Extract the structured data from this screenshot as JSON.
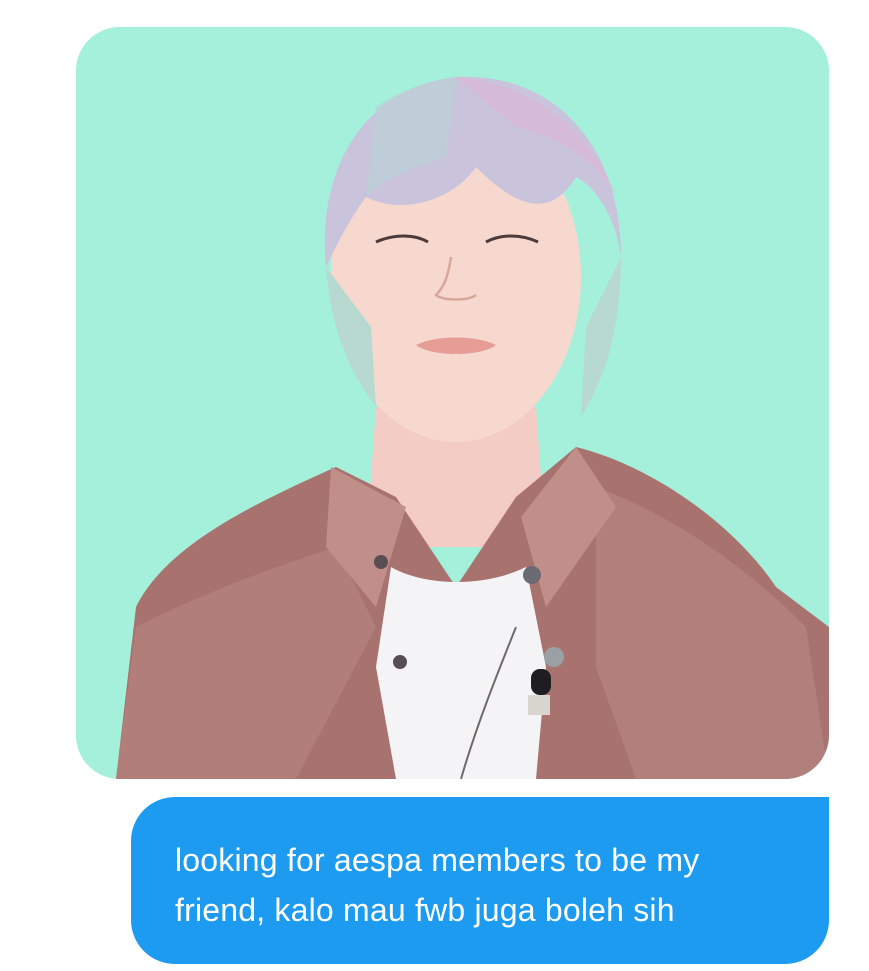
{
  "conversation": {
    "image_message": {
      "alt_icon": "photo-attachment",
      "background_color": "#a5f0db"
    },
    "text_message": {
      "text": "looking for aespa members to be my friend, kalo mau fwb juga boleh sih",
      "bubble_color": "#1d9bf0",
      "text_color": "#ffffff"
    }
  }
}
